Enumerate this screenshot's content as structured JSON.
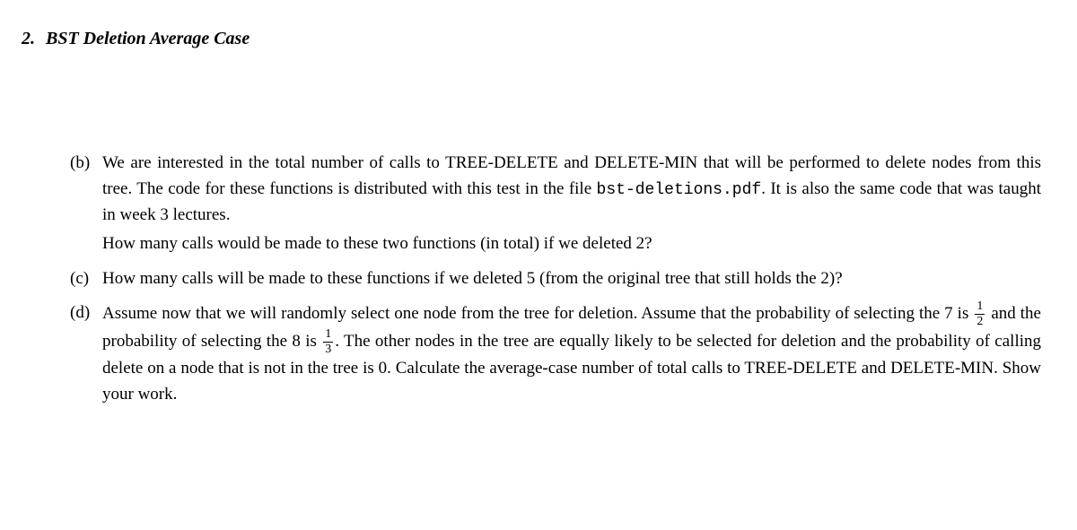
{
  "header": {
    "number": "2.",
    "title": "BST Deletion Average Case"
  },
  "subparts": {
    "b": {
      "label": "(b)",
      "p1_prefix": "We are interested in the total number of calls to TREE-DELETE and DELETE-MIN that will be performed to delete nodes from this tree. The code for these functions is distributed with this test in the file ",
      "p1_code": "bst-deletions.pdf",
      "p1_suffix": ". It is also the same code that was taught in week 3 lectures.",
      "p2": "How many calls would be made to these two functions (in total) if we deleted 2?"
    },
    "c": {
      "label": "(c)",
      "text": "How many calls will be made to these functions if we deleted 5 (from the original tree that still holds the 2)?"
    },
    "d": {
      "label": "(d)",
      "prefix": "Assume now that we will randomly select one node from the tree for deletion. Assume that the probability of selecting the 7 is ",
      "frac1_num": "1",
      "frac1_den": "2",
      "mid": " and the probability of selecting the 8 is ",
      "frac2_num": "1",
      "frac2_den": "3",
      "suffix": ". The other nodes in the tree are equally likely to be selected for deletion and the probability of calling delete on a node that is not in the tree is 0. Calculate the average-case number of total calls to TREE-DELETE and DELETE-MIN. Show your work."
    }
  }
}
